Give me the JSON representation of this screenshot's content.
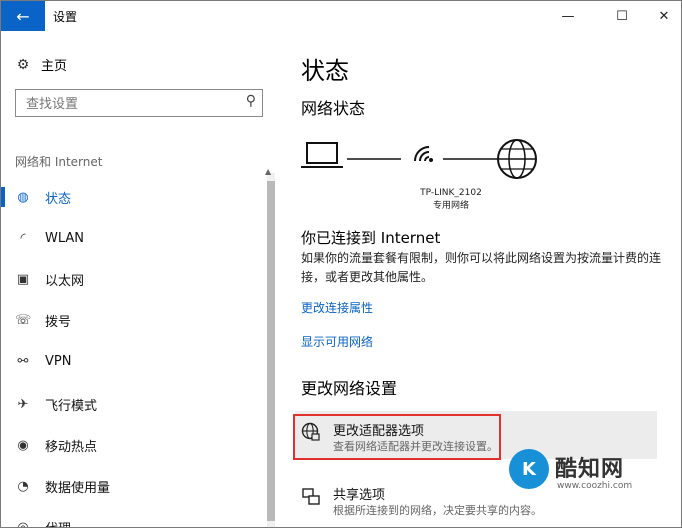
{
  "window": {
    "title": "设置",
    "back_glyph": "←",
    "minimize_glyph": "—",
    "maximize_glyph": "☐",
    "close_glyph": "✕"
  },
  "sidebar": {
    "home_label": "主页",
    "search_placeholder": "查找设置",
    "section_label": "网络和 Internet",
    "items": [
      {
        "label": "状态",
        "icon": "status-icon",
        "glyph": "◍",
        "active": true
      },
      {
        "label": "WLAN",
        "icon": "wifi-icon",
        "glyph": "◜"
      },
      {
        "label": "以太网",
        "icon": "ethernet-icon",
        "glyph": "▣"
      },
      {
        "label": "拨号",
        "icon": "dialup-icon",
        "glyph": "☏"
      },
      {
        "label": "VPN",
        "icon": "vpn-icon",
        "glyph": "⚯"
      },
      {
        "label": "飞行模式",
        "icon": "airplane-icon",
        "glyph": "✈"
      },
      {
        "label": "移动热点",
        "icon": "hotspot-icon",
        "glyph": "◉"
      },
      {
        "label": "数据使用量",
        "icon": "data-usage-icon",
        "glyph": "◔"
      },
      {
        "label": "代理",
        "icon": "proxy-icon",
        "glyph": "◎"
      }
    ],
    "accent": "#0a64c8"
  },
  "main": {
    "title": "状态",
    "network_status_heading": "网络状态",
    "network_name": "TP-LINK_2102",
    "network_type": "专用网络",
    "connected_heading": "你已连接到 Internet",
    "connected_desc": "如果你的流量套餐有限制，则你可以将此网络设置为按流量计费的连接，或者更改其他属性。",
    "link_change_props": "更改连接属性",
    "link_show_networks": "显示可用网络",
    "change_settings_heading": "更改网络设置",
    "settings": [
      {
        "title": "更改适配器选项",
        "desc": "查看网络适配器并更改连接设置。",
        "icon": "adapter-icon"
      },
      {
        "title": "共享选项",
        "desc": "根据所连接到的网络，决定要共享的内容。",
        "icon": "sharing-icon"
      }
    ],
    "highlight_color": "#e0322b"
  },
  "watermark": {
    "logo_letter": "K",
    "name": "酷知网",
    "url": "www.coozhi.com"
  }
}
